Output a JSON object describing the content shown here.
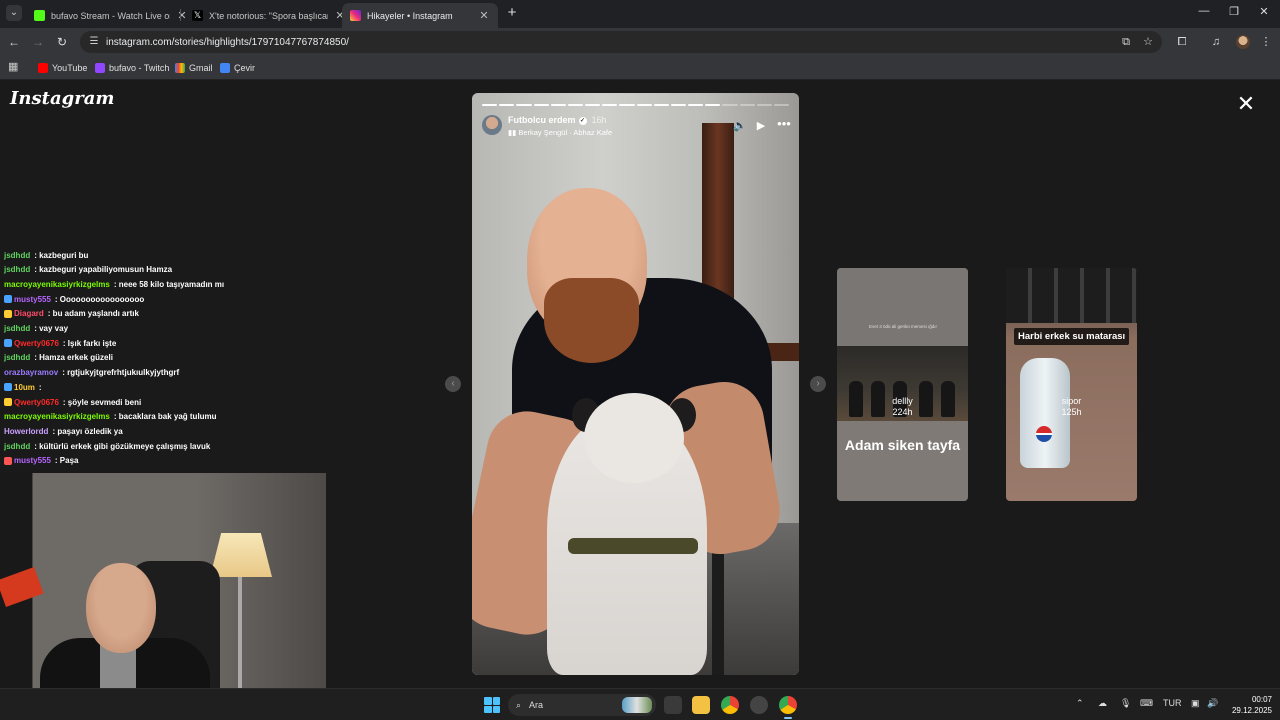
{
  "browser": {
    "tabs": [
      {
        "title": "bufavo Stream - Watch Live on",
        "favicon_color": "#53fc18",
        "active": false
      },
      {
        "title": "X'te notorious: \"Spora başlıcam",
        "favicon_color": "#000000",
        "active": false
      },
      {
        "title": "Hikayeler • Instagram",
        "favicon_color": "#e1306c",
        "active": true
      }
    ],
    "new_tab_label": "+",
    "url": "instagram.com/stories/highlights/17971047767874850/",
    "bookmarks": [
      {
        "label": "YouTube",
        "icon": "youtube-icon",
        "color": "#ff0000"
      },
      {
        "label": "bufavo - Twitch",
        "icon": "twitch-icon",
        "color": "#9146ff"
      },
      {
        "label": "Gmail",
        "icon": "gmail-icon",
        "color": "#ea4335"
      },
      {
        "label": "Çevir",
        "icon": "translate-icon",
        "color": "#4285f4"
      }
    ]
  },
  "instagram": {
    "logo": "Instagram",
    "story": {
      "username": "Futbolcu erdem",
      "time": "16h",
      "music": "Berkay Şengül · Abhaz Kafe",
      "segments_total": 18,
      "segments_done": 14
    },
    "previews": [
      {
        "title": "Adam siken tayfa",
        "user": "dellly",
        "time": "224h",
        "tiny_text": "Evet 3 ödü ali gerikü memesi ığdır"
      },
      {
        "title": "Harbi erkek su matarası",
        "user": "sipor",
        "time": "125h"
      }
    ]
  },
  "chat": {
    "lines": [
      {
        "user": "jsdhdd",
        "color": "#5fd35f",
        "text": ": kazbeguri bu"
      },
      {
        "user": "jsdhdd",
        "color": "#5fd35f",
        "text": ": kazbeguri yapabiliyomusun Hamza"
      },
      {
        "user": "macroyayenikasiyrkizgelms",
        "color": "#7cfc00",
        "text": ": neee 58 kilo taşıyamadın mı"
      },
      {
        "user": "musty555",
        "color": "#b666ff",
        "text": ": Ooooooooooooooooo"
      },
      {
        "user": "Diagard",
        "color": "#ff4d6a",
        "text": ": bu adam yaşlandı artık"
      },
      {
        "user": "jsdhdd",
        "color": "#5fd35f",
        "text": ": vay vay"
      },
      {
        "user": "Qwerty0676",
        "color": "#ff2a2a",
        "text": ": Işık farkı işte"
      },
      {
        "user": "jsdhdd",
        "color": "#5fd35f",
        "text": ": Hamza erkek güzeli"
      },
      {
        "user": "orazbayramov",
        "color": "#9b7bff",
        "text": ": rgtjukyjtgrefrhtjukıulkyjythgrf"
      },
      {
        "user": "10um",
        "color": "#ffcc33",
        "text": ":"
      },
      {
        "user": "Qwerty0676",
        "color": "#ff2a2a",
        "text": ": şöyle sevmedi beni"
      },
      {
        "user": "macroyayenikasiyrkizgelms",
        "color": "#7cfc00",
        "text": ": bacaklara bak yağ tulumu"
      },
      {
        "user": "Howerlordd",
        "color": "#c9a0ff",
        "text": ": paşayı özledik ya"
      },
      {
        "user": "jsdhdd",
        "color": "#5fd35f",
        "text": ": kültürlü erkek gibi gözükmeye çalışmış lavuk"
      },
      {
        "user": "musty555",
        "color": "#b666ff",
        "text": ": Paşa"
      }
    ]
  },
  "taskbar": {
    "search_label": "Ara",
    "language": "TUR",
    "time": "00:07",
    "date": "29.12.2025"
  }
}
